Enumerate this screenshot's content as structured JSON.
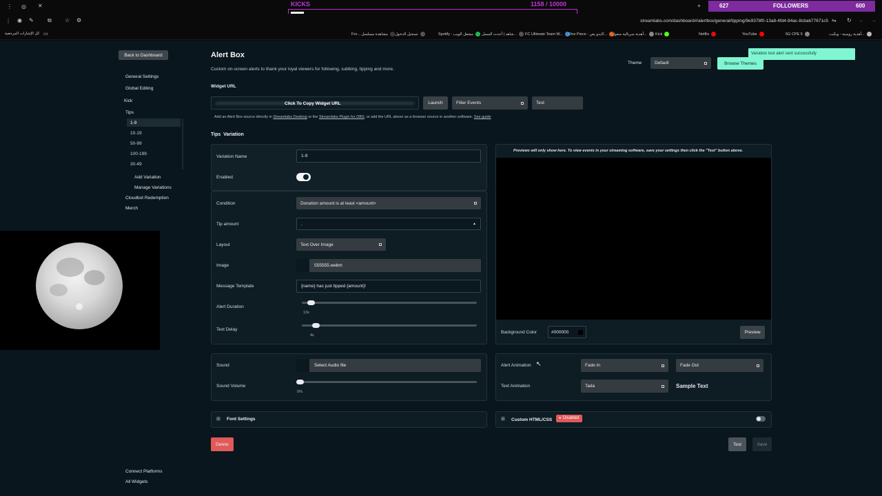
{
  "browser": {
    "kicks_label": "KICKS",
    "kicks_count": "1158",
    "kicks_goal": "/ 10000",
    "kicks_progress": 0.1158,
    "followers_count": "627",
    "followers_label": "FOLLOWERS",
    "followers_goal": "600",
    "url": "streamlabs.com/dashboard#/alertbox/general/tipping/9e9378f0-13a8-4fd4-84ac-8cbab77671c5",
    "all_bookmarks": "كل الإشارات المرجعية",
    "bookmarks": [
      {
        "label": "Fro... مشاهدة مسلسل",
        "color": "#3a3a3a"
      },
      {
        "label": "تسجيل الدخول",
        "color": "#555"
      },
      {
        "label": "Spotify - مشغل الويب",
        "color": "#1db954"
      },
      {
        "label": "شاهد | أحدث المسل...",
        "color": "#555"
      },
      {
        "label": "FC Ultimate Team W...",
        "color": "#3a8ad6"
      },
      {
        "label": "One Piece - كايدو يض...",
        "color": "#e06020"
      },
      {
        "label": "أهدية سريالية منعول...",
        "color": "#888"
      },
      {
        "label": "Kick",
        "color": "#53fc18"
      },
      {
        "label": "Netflix",
        "color": "#e50914"
      },
      {
        "label": "YouTube",
        "color": "#ff0000"
      },
      {
        "label": "5G CPE 5",
        "color": "#888"
      },
      {
        "label": "أهدية روسية - ويكيب...",
        "color": "#bbb"
      }
    ]
  },
  "sidebar": {
    "back_label": "Back to Dashboard",
    "general_settings": "General Settings",
    "global_editing": "Global Editing",
    "kick": "Kick",
    "tips": "Tips",
    "variations": [
      "1-9",
      "10-19",
      "50-99",
      "100-199",
      "30-49"
    ],
    "add_variation": "Add Variation",
    "manage_variations": "Manage Variations",
    "cloudbot": "Cloudbot Redemption",
    "merch": "Merch",
    "connect_platforms": "Connect Platforms",
    "all_widgets": "All Widgets"
  },
  "header": {
    "title": "Alert Box",
    "subtitle": "Custom on-screen alerts to thank your loyal viewers for following, subbing, tipping and more.",
    "theme_label": "Theme",
    "theme_value": "Default",
    "browse_themes": "Browse Themes",
    "toast": "Variation test alert sent successfully"
  },
  "widget": {
    "section_label": "Widget URL",
    "copy_label": "Click To Copy Widget URL",
    "launch": "Launch",
    "filter_events": "Filter Events",
    "test": "Test",
    "hint_pre": "Add an Alert Box source directly in",
    "hint_link1": "Streamlabs Desktop",
    "hint_mid": "or the",
    "hint_link2": "Streamlabs Plugin for OBS",
    "hint_post": ", or add the URL above as a browser source in another software.",
    "hint_link3": "See guide"
  },
  "variation": {
    "section_title": "Tips  Variation",
    "name_label": "Variation Name",
    "name_value": "1-9",
    "enabled_label": "Enabled",
    "condition_label": "Condition",
    "condition_value": "Donation amount is at least <amount>",
    "tip_amount_label": "Tip amount",
    "tip_amount_value": ".",
    "layout_label": "Layout",
    "layout_value": "Text Over Image",
    "image_label": "Image",
    "image_value": "555555.webm",
    "template_label": "Message Template",
    "template_value": "{name} has just tipped {amount}!",
    "duration_label": "Alert Duration",
    "duration_value": "13s",
    "duration_level": 0.03,
    "delay_label": "Text Delay",
    "delay_value": "4s",
    "delay_level": 0.06
  },
  "preview": {
    "note": "Previews will only show here. To view events in your streaming software, save your settings then click the \"Test\" button above.",
    "bg_label": "Background Color",
    "bg_value": "#000000",
    "preview_button": "Preview"
  },
  "sound": {
    "sound_label": "Sound",
    "sound_value": "Select Audio file",
    "volume_label": "Sound Volume",
    "volume_value": "0%",
    "volume_level": 0
  },
  "animation": {
    "alert_label": "Alert Animation",
    "in_value": "Fade In",
    "out_value": "Fade Out",
    "text_label": "Text Animation",
    "text_value": "Tada",
    "sample": "Sample Text"
  },
  "font_settings": "Font Settings",
  "custom_html": "Custom HTML/CSS",
  "custom_status": "Disabled",
  "footer": {
    "delete": "Delete",
    "test": "Test",
    "save": "Save"
  },
  "colors": {
    "accent_green": "#80f5d2",
    "danger": "#e05a5a",
    "kick_purple": "#c030d0"
  }
}
